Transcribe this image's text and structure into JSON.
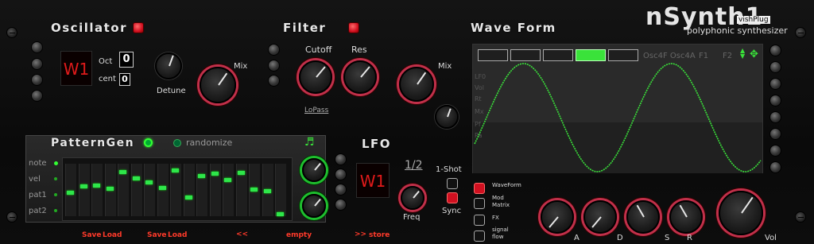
{
  "brand": {
    "name": "nSynth1",
    "maker": "vishPlug",
    "subtitle": "polyphonic synthesizer"
  },
  "oscillator": {
    "title": "Oscillator",
    "display": "W1",
    "oct_label": "Oct",
    "oct_value": "0",
    "cent_label": "cent",
    "cent_value": "0",
    "detune_label": "Detune",
    "mix_label": "Mix"
  },
  "filter": {
    "title": "Filter",
    "cutoff_label": "Cutoff",
    "res_label": "Res",
    "mix_label": "Mix",
    "type": "LoPass"
  },
  "waveform": {
    "title": "Wave Form",
    "overlay": "Osc4F Osc4A",
    "f1": "F1",
    "f2": "F2",
    "side_labels": [
      "LF0",
      "Vol",
      "Rt",
      "Mx",
      "Pf",
      "Pa",
      "Pd"
    ]
  },
  "patterngen": {
    "title": "PatternGen",
    "randomize": "randomize",
    "rows": [
      "note",
      "vel",
      "pat1",
      "pat2"
    ]
  },
  "lfo": {
    "title": "LFO",
    "display": "W1",
    "ratio": "1/2",
    "oneshot": "1-Shot",
    "freq_label": "Freq",
    "sync_label": "Sync"
  },
  "modes": {
    "waveform": "WaveForm",
    "mod_matrix": "Mod\nMatrix",
    "fx": "FX",
    "signal_flow": "signal\nflow"
  },
  "adsr": {
    "a": "A",
    "d": "D",
    "s": "S",
    "r": "R",
    "vol": "Vol"
  },
  "bottom_bar": {
    "save1": "Save",
    "load1": "Load",
    "save2": "Save",
    "load2": "Load",
    "prev": "<<",
    "preset": "empty",
    "next": ">>",
    "store": "store"
  },
  "colors": {
    "accent_red": "#d01020",
    "accent_green": "#2ee64a",
    "wave": "#3ae23a"
  }
}
